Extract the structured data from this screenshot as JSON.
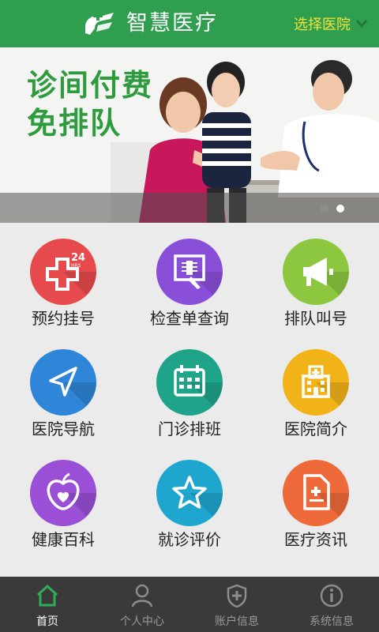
{
  "header": {
    "app_title": "智慧医疗",
    "hospital_select_label": "选择医院"
  },
  "banner": {
    "headline_line1": "诊间付费",
    "headline_line2": "免排队",
    "slide_count": 2,
    "active_slide": 2
  },
  "features": [
    {
      "label": "预约挂号",
      "icon": "24-hours-medical-cross-icon",
      "color": "#e74a4d"
    },
    {
      "label": "检查单查询",
      "icon": "xray-report-icon",
      "color": "#8a4fd9"
    },
    {
      "label": "排队叫号",
      "icon": "megaphone-icon",
      "color": "#8dc63f"
    },
    {
      "label": "医院导航",
      "icon": "navigation-arrow-icon",
      "color": "#2f86d8"
    },
    {
      "label": "门诊排班",
      "icon": "calendar-icon",
      "color": "#1fa48a"
    },
    {
      "label": "医院简介",
      "icon": "hospital-building-icon",
      "color": "#f2b318"
    },
    {
      "label": "健康百科",
      "icon": "apple-heart-icon",
      "color": "#9a4fd6"
    },
    {
      "label": "就诊评价",
      "icon": "star-icon",
      "color": "#1ea6cf"
    },
    {
      "label": "医疗资讯",
      "icon": "document-plus-icon",
      "color": "#ef6a3a"
    }
  ],
  "bottom_nav": [
    {
      "label": "首页",
      "icon": "home-icon",
      "active": true
    },
    {
      "label": "个人中心",
      "icon": "user-icon",
      "active": false
    },
    {
      "label": "账户信息",
      "icon": "shield-plus-icon",
      "active": false
    },
    {
      "label": "系统信息",
      "icon": "info-icon",
      "active": false
    }
  ],
  "colors": {
    "header_bg": "#2f9e4f",
    "hospital_select": "#f3e23a",
    "nav_bg": "#3a3a3a",
    "active_home_icon": "#2fae5a"
  }
}
